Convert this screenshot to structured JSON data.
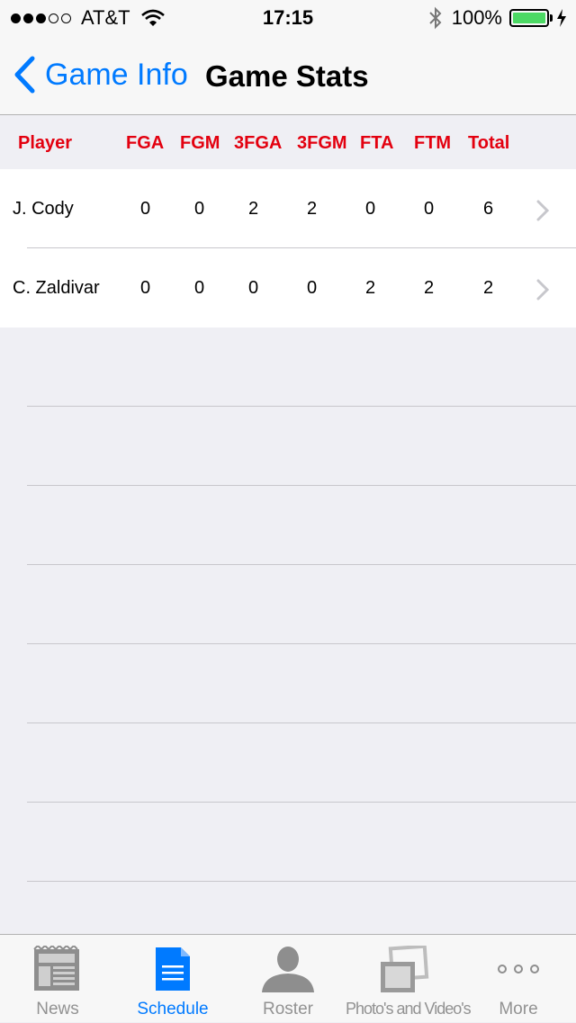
{
  "status_bar": {
    "carrier": "AT&T",
    "time": "17:15",
    "battery": "100%"
  },
  "nav": {
    "back_label": "Game Info",
    "title": "Game Stats"
  },
  "table": {
    "headers": [
      "Player",
      "FGA",
      "FGM",
      "3FGA",
      "3FGM",
      "FTA",
      "FTM",
      "Total"
    ],
    "rows": [
      {
        "player": "J. Cody",
        "fga": "0",
        "fgm": "0",
        "fga3": "2",
        "fgm3": "2",
        "fta": "0",
        "ftm": "0",
        "total": "6"
      },
      {
        "player": "C. Zaldivar",
        "fga": "0",
        "fgm": "0",
        "fga3": "0",
        "fgm3": "0",
        "fta": "2",
        "ftm": "2",
        "total": "2"
      }
    ]
  },
  "tabs": [
    {
      "label": "News",
      "icon": "newspaper-icon"
    },
    {
      "label": "Schedule",
      "icon": "document-icon"
    },
    {
      "label": "Roster",
      "icon": "person-icon"
    },
    {
      "label": "Photo's and Video's",
      "icon": "photos-icon"
    },
    {
      "label": "More",
      "icon": "more-dots-icon"
    }
  ],
  "colors": {
    "accent": "#007aff",
    "header_text": "#e3000f",
    "battery": "#4cd964"
  }
}
